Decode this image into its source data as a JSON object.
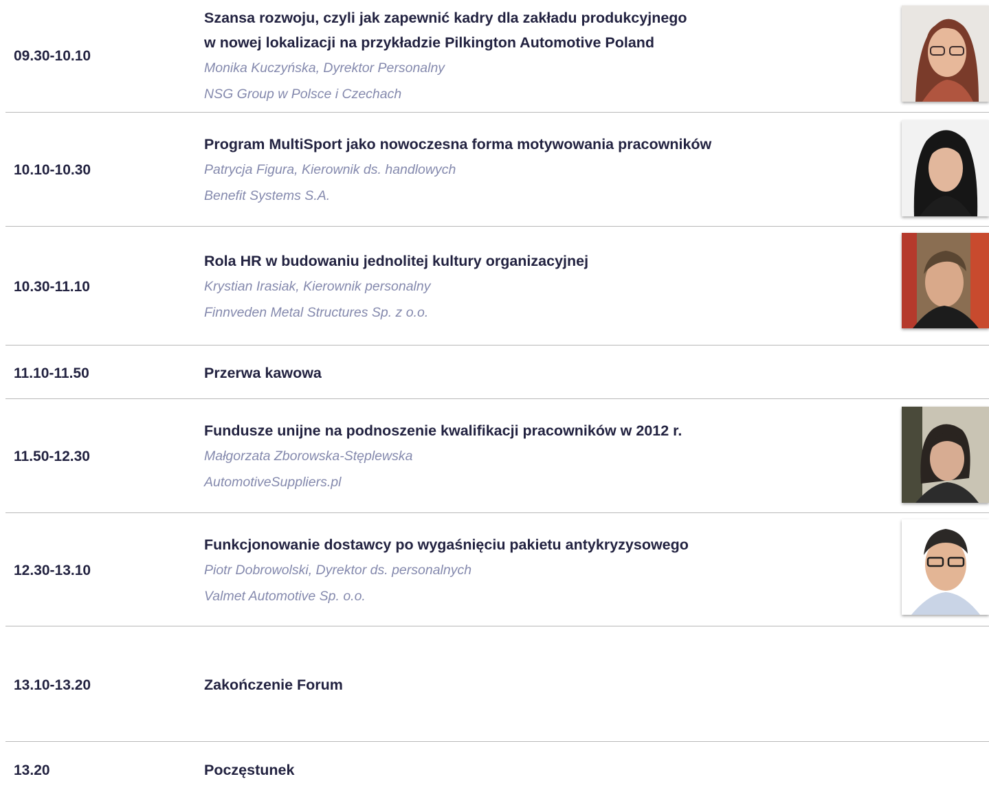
{
  "agenda": {
    "items": [
      {
        "time": "09.30-10.10",
        "title_lines": [
          "Szansa rozwoju, czyli jak zapewnić kadry dla zakładu produkcyjnego",
          "w nowej lokalizacji na przykładzie Pilkington Automotive Poland"
        ],
        "speaker": "Monika Kuczyńska, Dyrektor Personalny",
        "company": "NSG Group w Polsce i Czechach"
      },
      {
        "time": "10.10-10.30",
        "title": "Program MultiSport jako nowoczesna forma motywowania pracowników",
        "speaker": "Patrycja Figura, Kierownik ds. handlowych",
        "company": "Benefit Systems S.A."
      },
      {
        "time": "10.30-11.10",
        "title": "Rola HR w budowaniu jednolitej kultury organizacyjnej",
        "speaker": "Krystian Irasiak, Kierownik personalny",
        "company": "Finnveden Metal Structures Sp. z o.o."
      },
      {
        "time": "11.10-11.50",
        "title": "Przerwa kawowa"
      },
      {
        "time": "11.50-12.30",
        "title": "Fundusze unijne na podnoszenie kwalifikacji pracowników w 2012 r.",
        "speaker": "Małgorzata Zborowska-Stęplewska",
        "company": "AutomotiveSuppliers.pl"
      },
      {
        "time": "12.30-13.10",
        "title": "Funkcjonowanie dostawcy po wygaśnięciu pakietu antykryzysowego",
        "speaker": "Piotr Dobrowolski, Dyrektor ds. personalnych",
        "company": "Valmet Automotive Sp. o.o."
      },
      {
        "time": "13.10-13.20",
        "title": "Zakończenie Forum"
      },
      {
        "time": "13.20",
        "title": "Poczęstunek"
      }
    ]
  },
  "colors": {
    "title": "#222240",
    "speaker": "#8489ad",
    "separator": "#b8b8b8"
  },
  "icons": {
    "photo": "speaker-portrait-icon"
  }
}
